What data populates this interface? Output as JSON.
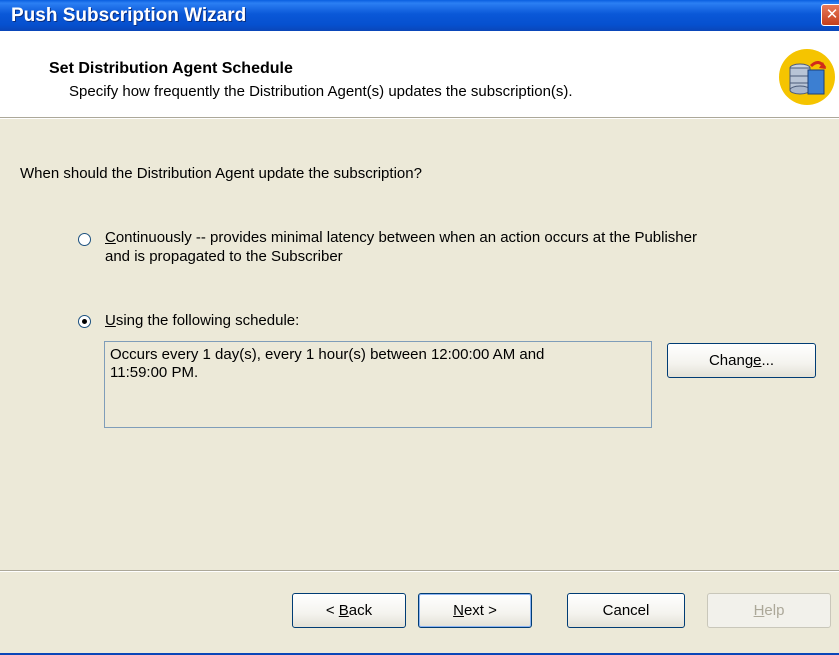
{
  "window": {
    "title": "Push Subscription Wizard"
  },
  "header": {
    "heading": "Set Distribution Agent Schedule",
    "subheading": "Specify how frequently the Distribution Agent(s) updates the subscription(s).",
    "icon": "database-refresh-icon"
  },
  "question": "When should the Distribution Agent update the subscription?",
  "options": [
    {
      "accel": "C",
      "label_rest": "ontinuously -- provides minimal latency between when an action occurs at the Publisher",
      "label_line2": "and is propagated to the Subscriber",
      "checked": false
    },
    {
      "accel": "U",
      "label_rest": "sing the following schedule:",
      "checked": true
    }
  ],
  "schedule": {
    "description_line1": "Occurs every 1 day(s), every 1 hour(s) between 12:00:00 AM and",
    "description_line2": "11:59:00 PM.",
    "change_pre": "Chang",
    "change_accel": "e",
    "change_post": "..."
  },
  "buttons": {
    "back_pre": "< ",
    "back_accel": "B",
    "back_post": "ack",
    "next_accel": "N",
    "next_post": "ext >",
    "cancel": "Cancel",
    "help_accel": "H",
    "help_post": "elp"
  },
  "colors": {
    "titlebar": "#0a58d8",
    "dialog_bg": "#ece9d8",
    "header_bg": "#ffffff",
    "icon_accent": "#f5c400"
  }
}
